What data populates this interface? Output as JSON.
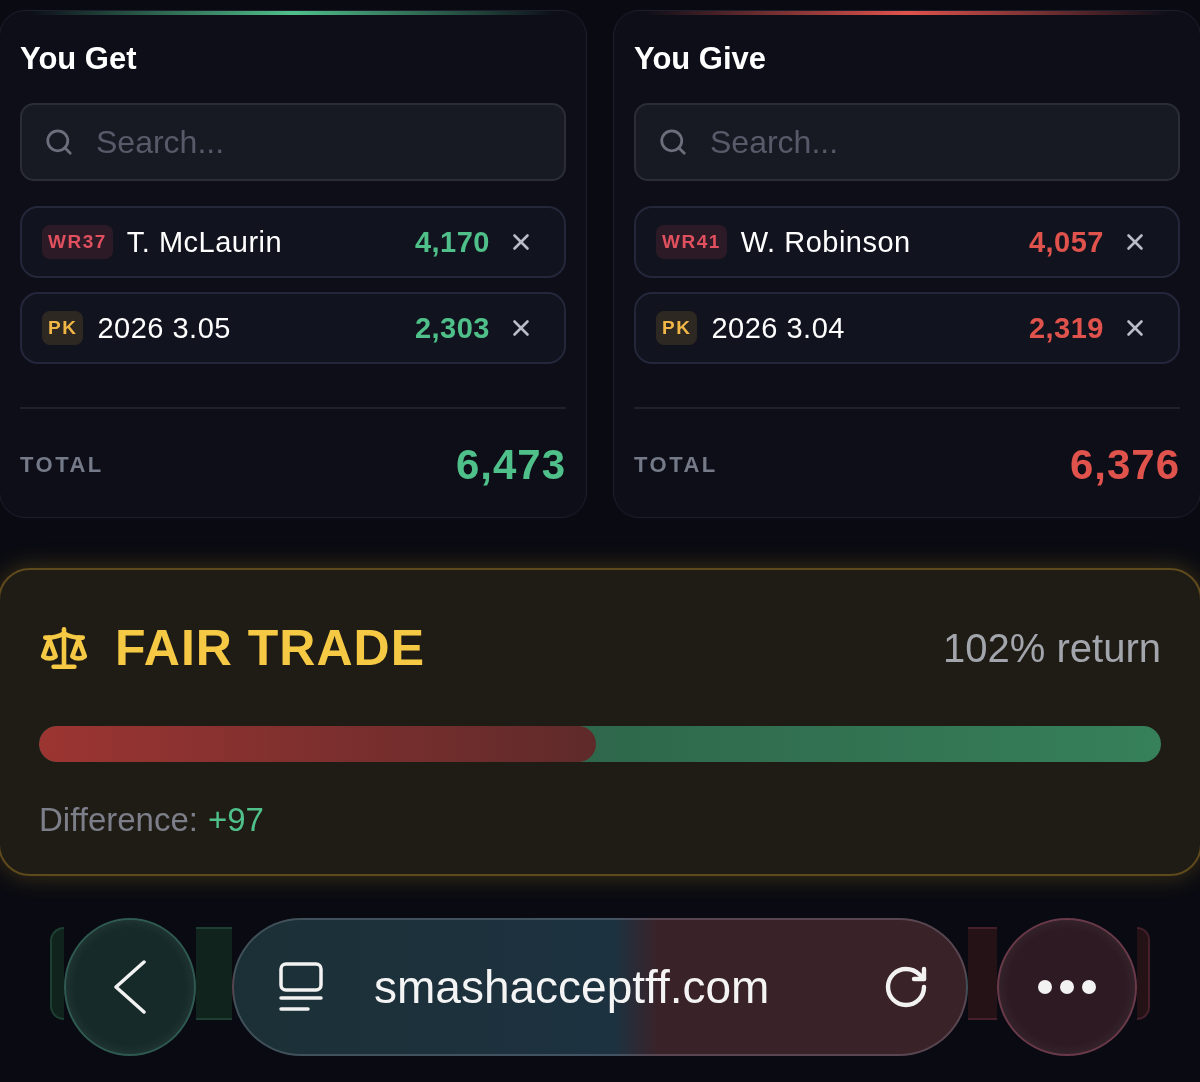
{
  "sides": [
    {
      "kind": "get",
      "title": "You Get",
      "search": {
        "placeholder": "Search..."
      },
      "assets": [
        {
          "badge": {
            "text": "WR37",
            "color": "#e0505f"
          },
          "name": "T. McLaurin",
          "value": "4,170"
        },
        {
          "badge": {
            "text": "PK",
            "color": "#f0b646"
          },
          "name": "2026 3.05",
          "value": "2,303"
        }
      ],
      "total": {
        "label": "TOTAL",
        "value": "6,473"
      }
    },
    {
      "kind": "give",
      "title": "You Give",
      "search": {
        "placeholder": "Search..."
      },
      "assets": [
        {
          "badge": {
            "text": "WR41",
            "color": "#e0505f"
          },
          "name": "W. Robinson",
          "value": "4,057"
        },
        {
          "badge": {
            "text": "PK",
            "color": "#f0b646"
          },
          "name": "2026 3.04",
          "value": "2,319"
        }
      ],
      "total": {
        "label": "TOTAL",
        "value": "6,376"
      }
    }
  ],
  "verdict": {
    "title": "FAIR TRADE",
    "return": "102% return",
    "balance": {
      "level": 0.496
    },
    "difference": {
      "label": "Difference:",
      "value": "+97"
    }
  },
  "browser": {
    "url": "smashacceptff.com"
  }
}
